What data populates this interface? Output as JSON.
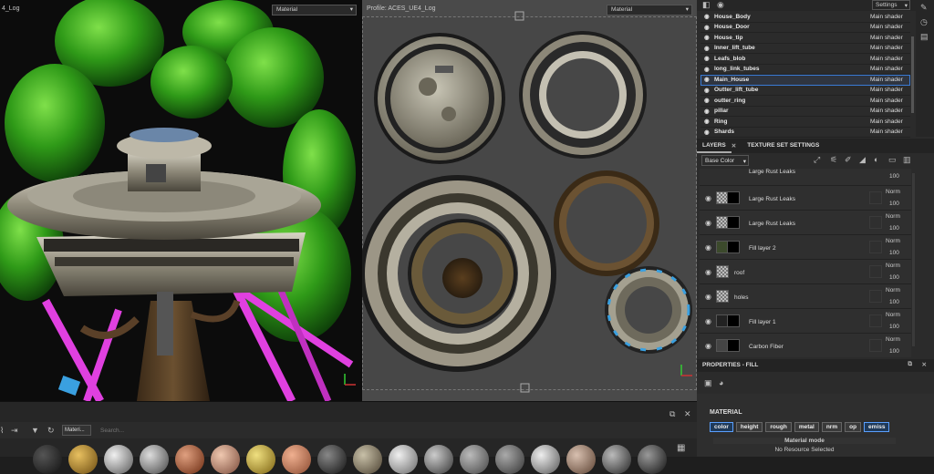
{
  "viewport3d": {
    "profile_label": "4_Log",
    "dropdown_value": "Material"
  },
  "viewport2d": {
    "profile_label": "Profile: ACES_UE4_Log",
    "dropdown_value": "Material"
  },
  "texture_sets": {
    "settings_label": "Settings",
    "rows": [
      {
        "name": "House_Body",
        "shader": "Main shader"
      },
      {
        "name": "House_Door",
        "shader": "Main shader"
      },
      {
        "name": "House_tip",
        "shader": "Main shader"
      },
      {
        "name": "Inner_lift_tube",
        "shader": "Main shader"
      },
      {
        "name": "Leafs_blob",
        "shader": "Main shader"
      },
      {
        "name": "long_link_tubes",
        "shader": "Main shader"
      },
      {
        "name": "Main_House",
        "shader": "Main shader"
      },
      {
        "name": "Outter_lift_tube",
        "shader": "Main shader"
      },
      {
        "name": "outter_ring",
        "shader": "Main shader"
      },
      {
        "name": "pillar",
        "shader": "Main shader"
      },
      {
        "name": "Ring",
        "shader": "Main shader"
      },
      {
        "name": "Shards",
        "shader": "Main shader"
      }
    ],
    "selected": "Main_House"
  },
  "layers_panel": {
    "tab_layers": "LAYERS",
    "tab_texture_set_settings": "TEXTURE SET SETTINGS",
    "channel_dropdown": "Base Color",
    "partial_top_label": "Large Rust Leaks",
    "partial_top_opacity": "100",
    "layers": [
      {
        "name": "Large Rust Leaks",
        "blend": "Norm",
        "opacity": "100"
      },
      {
        "name": "Large Rust Leaks",
        "blend": "Norm",
        "opacity": "100"
      },
      {
        "name": "Fill layer 2",
        "blend": "Norm",
        "opacity": "100"
      },
      {
        "name": "roof",
        "blend": "Norm",
        "opacity": "100"
      },
      {
        "name": "holes",
        "blend": "Norm",
        "opacity": "100"
      },
      {
        "name": "Fill layer 1",
        "blend": "Norm",
        "opacity": "100"
      },
      {
        "name": "Carbon Fiber",
        "blend": "Norm",
        "opacity": "100"
      }
    ]
  },
  "properties": {
    "title": "PROPERTIES - FILL",
    "section": "MATERIAL",
    "channels": [
      "color",
      "height",
      "rough",
      "metal",
      "nrm",
      "op",
      "emiss"
    ],
    "active_channels": [
      "color",
      "emiss"
    ],
    "material_mode_label": "Material mode",
    "material_mode_value": "No Resource Selected"
  },
  "shelf": {
    "tab_label": "Materi...",
    "search_placeholder": "Search..."
  },
  "colors": {
    "accent": "#3a7bd5",
    "neon_pink": "#e040e0",
    "leaf_green": "#39b81a"
  }
}
